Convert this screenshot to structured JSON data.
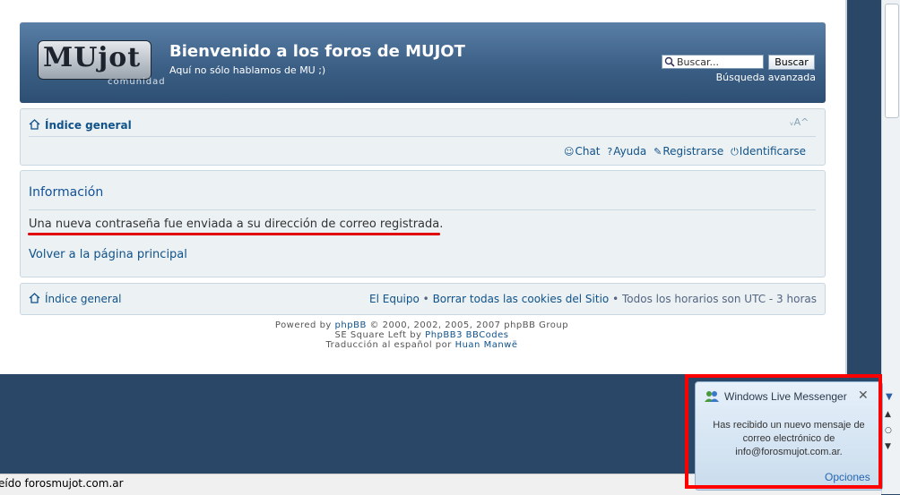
{
  "header": {
    "logo_text": "MUjot",
    "logo_sub": "comunidad",
    "title": "Bienvenido a los foros de MUJOT",
    "description": "Aquí no sólo hablamos de MU ;)",
    "search_value": "Buscar...",
    "search_button": "Buscar",
    "advanced_search": "Búsqueda avanzada"
  },
  "navbar": {
    "index_label": "Índice general",
    "links": {
      "chat": "Chat",
      "help": "Ayuda",
      "register": "Registrarse",
      "login": "Identificarse"
    }
  },
  "info": {
    "title": "Información",
    "message": "Una nueva contraseña fue enviada a su dirección de correo registrada.",
    "back_link": "Volver a la página principal"
  },
  "footer": {
    "index_label": "Índice general",
    "team": "El Equipo",
    "delete_cookies": "Borrar todas las cookies del Sitio",
    "timezone": "Todos los horarios son UTC - 3 horas",
    "separator": "•"
  },
  "copyright": {
    "powered_by": "Powered by",
    "phpbb": "phpBB",
    "phpbb_rest": "© 2000, 2002, 2005, 2007 phpBB Group",
    "style_prefix": "SE Square Left by",
    "style_link": "PhpBB3 BBCodes",
    "translation_prefix": "Traducción al español por",
    "translator": "Huan Manwë"
  },
  "statusbar": {
    "text": "eído forosmujot.com.ar"
  },
  "messenger": {
    "title": "Windows Live Messenger",
    "close": "✕",
    "body": "Has recibido un nuevo mensaje de correo electrónico de info@forosmujot.com.ar.",
    "options": "Opciones"
  },
  "colors": {
    "header_top": "#5a7fa6",
    "header_bottom": "#2e4f73",
    "link": "#105289",
    "panel": "#ecf1f3",
    "highlight": "#ff0000"
  }
}
